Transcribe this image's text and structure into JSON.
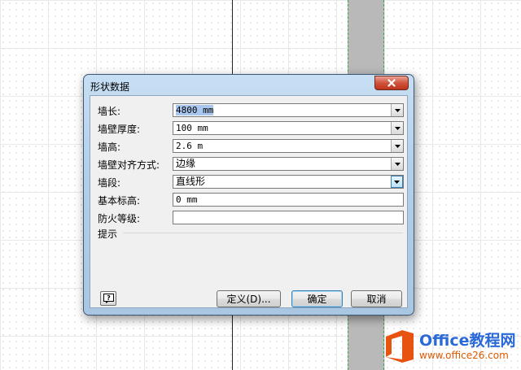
{
  "dialog": {
    "title": "形状数据",
    "fields": [
      {
        "label": "墙长:",
        "value": "4800 mm",
        "dropdown": true
      },
      {
        "label": "墙壁厚度:",
        "value": "100 mm",
        "dropdown": true
      },
      {
        "label": "墙高:",
        "value": "2.6 m",
        "dropdown": true
      },
      {
        "label": "墙壁对齐方式:",
        "value": "边缘",
        "dropdown": true
      },
      {
        "label": "墙段:",
        "value": "直线形",
        "dropdown": true
      },
      {
        "label": "基本标高:",
        "value": "0 mm",
        "dropdown": false
      },
      {
        "label": "防火等级:",
        "value": "",
        "dropdown": false
      }
    ],
    "hint_label": "提示",
    "buttons": {
      "define": "定义(D)...",
      "ok": "确定",
      "cancel": "取消"
    }
  },
  "watermark": {
    "name": "Office教程网",
    "url": "www.office26.com"
  },
  "colors": {
    "title_gradient": "#b3cfe9",
    "close_button": "#d0543c",
    "selection": "#a9c6ee",
    "wall": "#b9b9b9",
    "logo_orange": "#e8530f",
    "logo_blue": "#2a6ad8"
  },
  "icons": [
    "close-icon",
    "dropdown-arrow-icon",
    "help-icon",
    "office-logo-icon"
  ]
}
